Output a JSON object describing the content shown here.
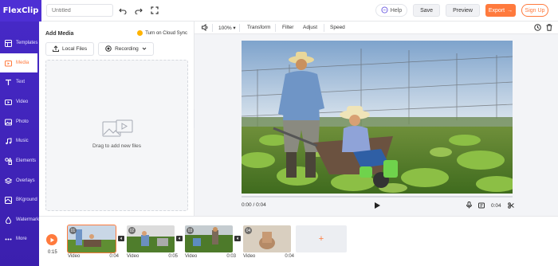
{
  "app": {
    "brand": "FlexClip",
    "project_title_placeholder": "Untitled"
  },
  "topbar": {
    "help_label": "Help",
    "save_label": "Save",
    "preview_label": "Preview",
    "export_label": "Export",
    "signup_label": "Sign Up"
  },
  "sidebar": {
    "items": [
      {
        "label": "Templates",
        "icon": "templates-icon"
      },
      {
        "label": "Media",
        "icon": "media-icon"
      },
      {
        "label": "Text",
        "icon": "text-icon"
      },
      {
        "label": "Video",
        "icon": "video-icon"
      },
      {
        "label": "Photo",
        "icon": "photo-icon"
      },
      {
        "label": "Music",
        "icon": "music-icon"
      },
      {
        "label": "Elements",
        "icon": "elements-icon"
      },
      {
        "label": "Overlays",
        "icon": "overlays-icon"
      },
      {
        "label": "BKground",
        "icon": "background-icon"
      },
      {
        "label": "Watermark",
        "icon": "watermark-icon"
      },
      {
        "label": "More",
        "icon": "more-icon"
      }
    ],
    "active_index": 1
  },
  "media_panel": {
    "title": "Add Media",
    "cloud_sync_label": "Turn on Cloud Sync",
    "local_files_label": "Local Files",
    "recording_label": "Recording",
    "drop_text": "Drag to add new files"
  },
  "toolbar": {
    "zoom": "100%",
    "transform_label": "Transform",
    "filter_label": "Filter",
    "adjust_label": "Adjust",
    "speed_label": "Speed"
  },
  "player": {
    "current_time": "0:00 / 0:04",
    "clip_duration": "0:04"
  },
  "timeline": {
    "total_time": "0:15",
    "clips": [
      {
        "num": "01",
        "type": "Video",
        "duration": "0:04"
      },
      {
        "num": "02",
        "type": "Video",
        "duration": "0:05"
      },
      {
        "num": "03",
        "type": "Video",
        "duration": "0:03"
      },
      {
        "num": "04",
        "type": "Video",
        "duration": "0:04"
      }
    ]
  },
  "colors": {
    "brand": "#4e2fd4",
    "accent": "#ff7a3d"
  }
}
